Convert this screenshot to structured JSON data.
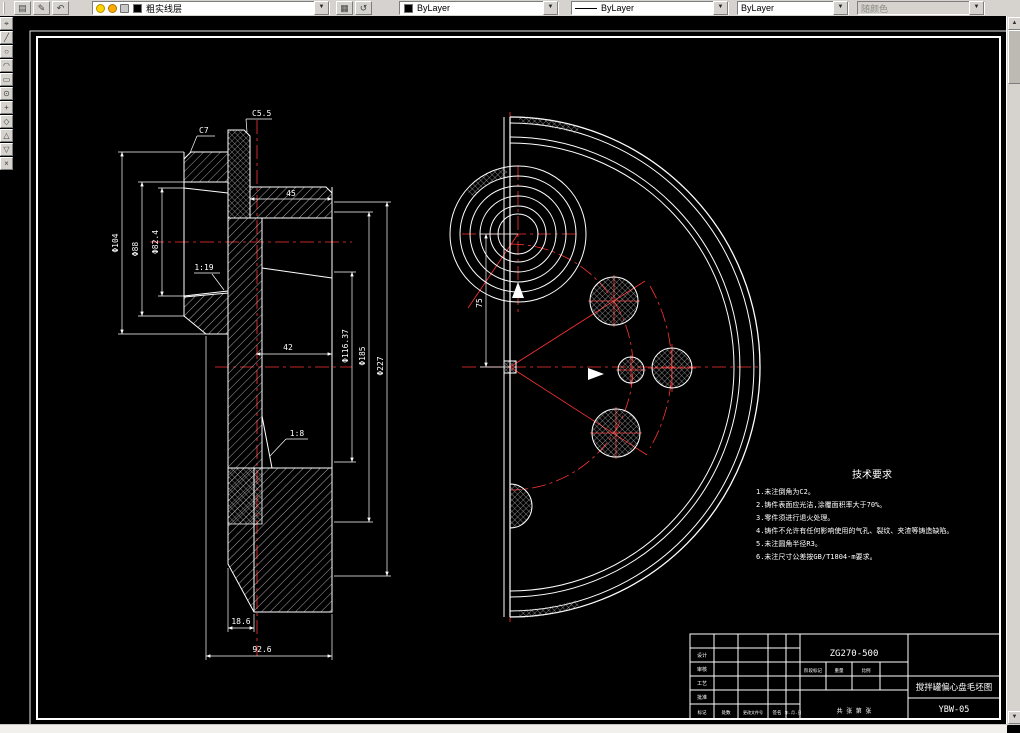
{
  "toolbar": {
    "icons": [
      {
        "name": "layer-properties-manager",
        "glyph": "▤"
      },
      {
        "name": "make-object-layer-current",
        "glyph": "✎"
      },
      {
        "name": "layer-previous",
        "glyph": "↶"
      },
      {
        "name": "layer-states-manager",
        "glyph": "▦"
      },
      {
        "name": "undo-layer-change",
        "glyph": "↺"
      }
    ],
    "layer": {
      "name": "粗实线层"
    },
    "color_label": "ByLayer",
    "linetype_label": "ByLayer",
    "lineweight_label": "ByLayer",
    "plotstyle_label": "随颜色"
  },
  "left_toolbar": {
    "icons": [
      {
        "name": "pointer-tool",
        "glyph": "⌖"
      },
      {
        "name": "line-tool",
        "glyph": "╱"
      },
      {
        "name": "circle-tool",
        "glyph": "○"
      },
      {
        "name": "arc-tool",
        "glyph": "◠"
      },
      {
        "name": "rectangle-tool",
        "glyph": "▭"
      },
      {
        "name": "donut-tool",
        "glyph": "⊙"
      },
      {
        "name": "point-tool",
        "glyph": "+"
      },
      {
        "name": "polygon-tool",
        "glyph": "◇"
      },
      {
        "name": "triangle-tool",
        "glyph": "△"
      },
      {
        "name": "hatch-tool",
        "glyph": "▽"
      },
      {
        "name": "erase-tool",
        "glyph": "×"
      }
    ]
  },
  "canvas": {
    "colors": {
      "background": "#000000",
      "line": "#ffffff",
      "centerline": "#ff3333"
    },
    "left_view": {
      "dims": {
        "c55": "C5.5",
        "c7": "C7",
        "d45": "45",
        "d42": "42",
        "taper_bore": "1:19",
        "taper_inner": "1:8",
        "d104": "Φ104",
        "d88": "Φ88",
        "d824": "Φ82.4",
        "d11637": "Φ116.37",
        "d185": "Φ185",
        "d227": "Φ227",
        "d186": "18.6",
        "d926": "92.6"
      }
    },
    "right_view": {
      "dims": {
        "eccentricity": "75"
      }
    },
    "tech": {
      "title": "技术要求",
      "notes": [
        "1.未注倒角为C2。",
        "2.铸件表面应光洁,涂覆面积率大于70%。",
        "3.零件须进行退火处理。",
        "4.铸件不允许有任何影响使用的气孔、裂纹、夹渣等铸造缺陷。",
        "5.未注圆角半径R3。",
        "6.未注尺寸公差按GB/T1804-m要求。"
      ]
    },
    "title_block": {
      "material": "ZG270-500",
      "drawing_title": "搅拌罐偏心盘毛坯图",
      "drawing_no": "YBW-05",
      "row_labels": [
        "标记",
        "处数",
        "更改文件号",
        "签名",
        "年.月.日"
      ],
      "side_labels": [
        "设计",
        "审核",
        "工艺",
        "批准"
      ],
      "info_labels": [
        "阶段标记",
        "重量",
        "比例"
      ],
      "sheet_label": "共 张 第 张"
    }
  }
}
